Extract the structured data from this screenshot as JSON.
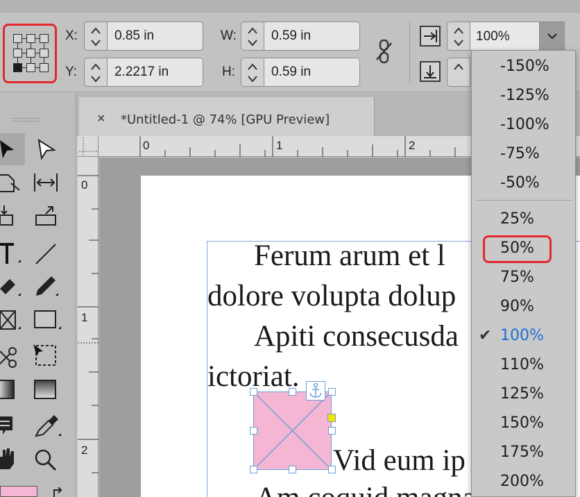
{
  "control_bar": {
    "x_label": "X:",
    "x_value": "0.85 in",
    "y_label": "Y:",
    "y_value": "2.2217 in",
    "w_label": "W:",
    "w_value": "0.59 in",
    "h_label": "H:",
    "h_value": "0.59 in",
    "scale_value": "100%"
  },
  "document_tab": {
    "close": "×",
    "title": "*Untitled-1 @ 74% [GPU Preview]"
  },
  "rulers": {
    "horizontal": [
      "0",
      "1",
      "2"
    ],
    "vertical": [
      "0",
      "1",
      "2"
    ]
  },
  "document_text": {
    "line1": "Ferum arum et l",
    "line2": "dolore volupta dolup",
    "line3": "Apiti consecusda",
    "line4": "ictoriat.",
    "line5": "Vid eum ip",
    "line6": "Am coquid magnam et e"
  },
  "scale_menu": {
    "items": [
      "-150%",
      "-125%",
      "-100%",
      "-75%",
      "-50%",
      "25%",
      "50%",
      "75%",
      "90%",
      "100%",
      "110%",
      "125%",
      "150%",
      "175%",
      "200%"
    ],
    "checked": "100%",
    "highlighted": "50%"
  },
  "colors": {
    "highlight_box": "#e3272e",
    "selected_item": "#1d6fd6",
    "frame_fill": "#f4b6d2",
    "frame_stroke": "#6f9fd8"
  }
}
